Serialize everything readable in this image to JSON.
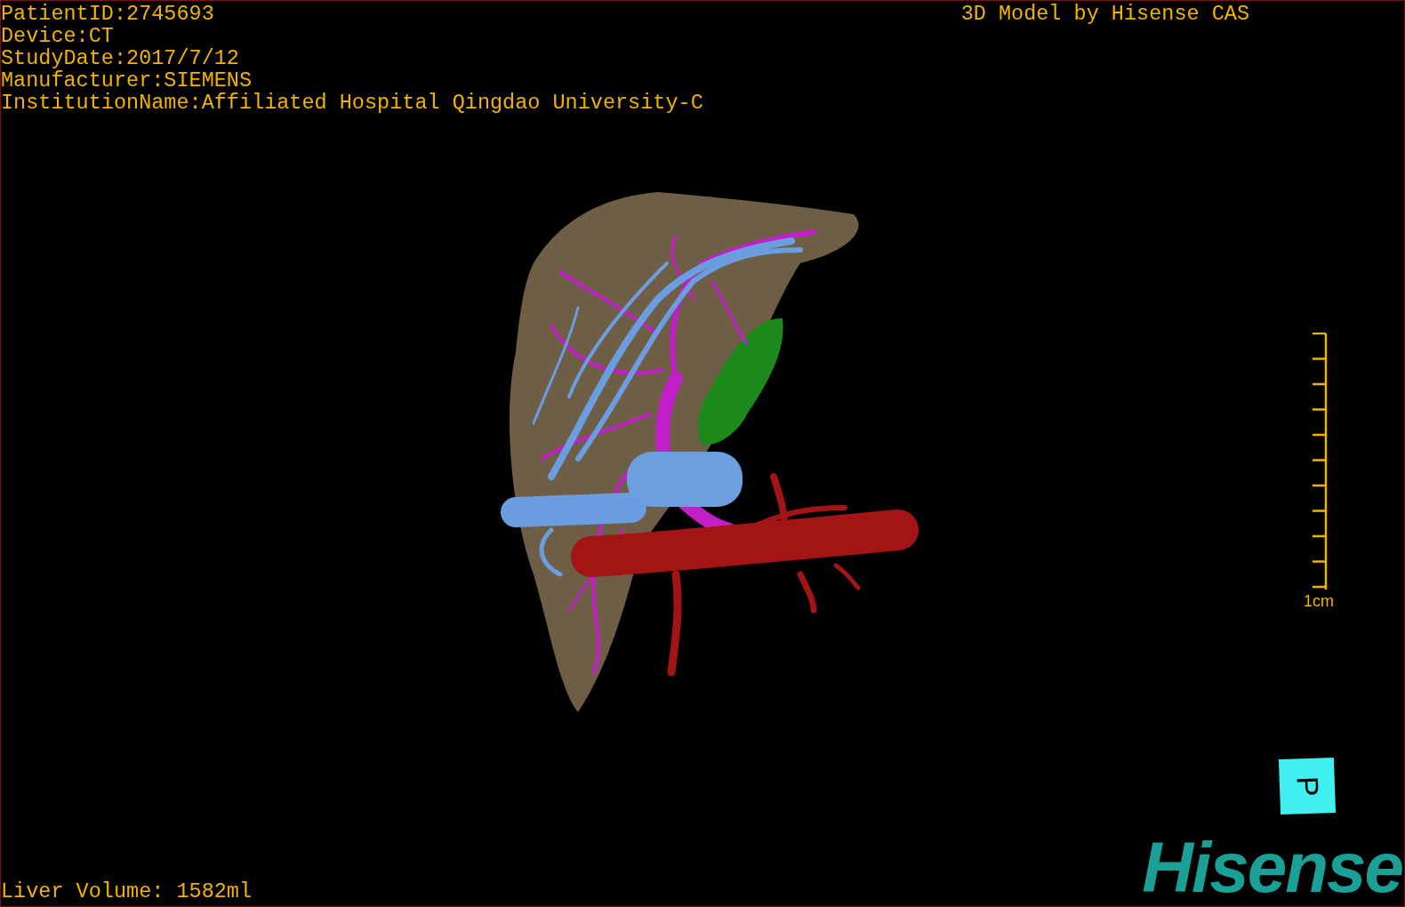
{
  "study_info": [
    "PatientID:2745693",
    "Device:CT",
    "StudyDate:2017/7/12",
    "Manufacturer:SIEMENS",
    "InstitutionName:Affiliated Hospital Qingdao University-C"
  ],
  "title": "3D Model by Hisense CAS",
  "scale_bar": {
    "label": "1cm"
  },
  "orientation_cube": {
    "label": "P"
  },
  "liver_volume": "Liver Volume: 1582ml",
  "logo": "Hisense"
}
